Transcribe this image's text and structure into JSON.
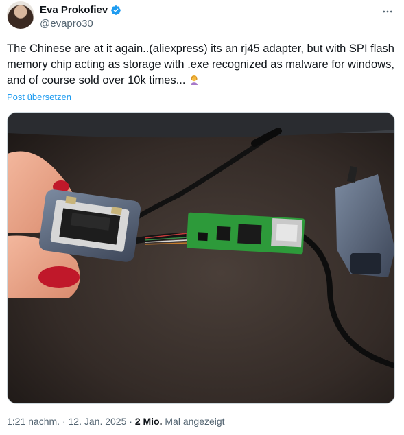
{
  "author": {
    "name": "Eva Prokofiev",
    "handle": "@evapro30",
    "verified": true,
    "verified_color": "#1d9bf0"
  },
  "more_icon": "more-horizontal-icon",
  "tweet": {
    "text": "The Chinese are at it again..(aliexpress) its an rj45 adapter, but with SPI flash memory chip acting as storage with .exe recognized as malware for windows, and of course sold over 10k times... ",
    "emoji": "woman-facepalming-emoji",
    "translate_label": "Post übersetzen"
  },
  "media": {
    "description_icon": "photo-image"
  },
  "meta": {
    "time": "1:21 nachm.",
    "separator1": " · ",
    "date": "12. Jan. 2025",
    "separator2": " · ",
    "views_count": "2 Mio.",
    "views_label": " Mal angezeigt"
  },
  "colors": {
    "text": "#0f1419",
    "secondary": "#536471",
    "link": "#1d9bf0"
  }
}
